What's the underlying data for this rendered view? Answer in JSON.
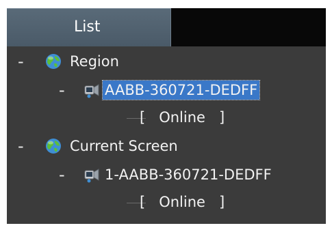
{
  "tab": {
    "label": "List"
  },
  "tree": {
    "groups": [
      {
        "toggle": "-",
        "label": "Region",
        "device": {
          "toggle": "-",
          "label": "AABB-360721-DEDFF",
          "status": "[   Online   ]"
        }
      },
      {
        "toggle": "-",
        "label": "Current Screen",
        "device": {
          "toggle": "-",
          "label": "1-AABB-360721-DEDFF",
          "status": "[   Online   ]"
        }
      }
    ]
  },
  "colors": {
    "panel": "#3b3b3b",
    "tab": "#52626f",
    "selection": "#3a78c8",
    "text": "#f2f2f2"
  }
}
